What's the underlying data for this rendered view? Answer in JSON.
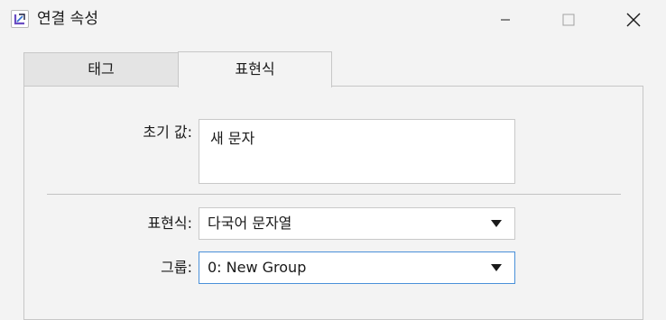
{
  "window": {
    "title": "연결 속성",
    "icons": {
      "app": "app-logo-icon",
      "minimize": "minimize-icon",
      "maximize": "maximize-icon",
      "close": "close-icon"
    }
  },
  "tabs": [
    {
      "label": "태그",
      "active": false
    },
    {
      "label": "표현식",
      "active": true
    }
  ],
  "form": {
    "initial_value_label": "초기 값:",
    "initial_value": "새 문자",
    "expression_label": "표현식:",
    "expression_value": "다국어 문자열",
    "group_label": "그룹:",
    "group_value": "0: New Group"
  },
  "colors": {
    "focus_border": "#4a90d9",
    "app_icon_accent": "#6a4cc2"
  }
}
